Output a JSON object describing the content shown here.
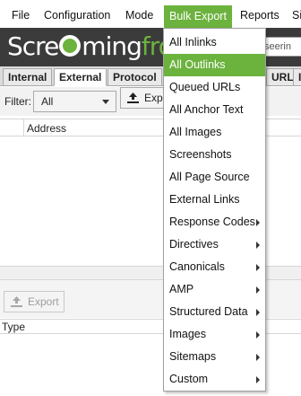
{
  "menubar": {
    "items": [
      {
        "label": "File"
      },
      {
        "label": "Configuration"
      },
      {
        "label": "Mode"
      },
      {
        "label": "Bulk Export"
      },
      {
        "label": "Reports"
      },
      {
        "label": "Si"
      }
    ]
  },
  "logo": {
    "part1": "Scre",
    "part2": "ming",
    "part3": "frog"
  },
  "search": {
    "value": "seerin"
  },
  "tabs": [
    {
      "label": "Internal"
    },
    {
      "label": "External"
    },
    {
      "label": "Protocol"
    },
    {
      "label": "URL"
    },
    {
      "label": "I"
    }
  ],
  "filter": {
    "label": "Filter:",
    "value": "All",
    "export_label": "Expo"
  },
  "table": {
    "address_header": "Address"
  },
  "lower": {
    "export_label": "Export",
    "type_header": "Type"
  },
  "dropdown": {
    "items": [
      {
        "label": "All Inlinks",
        "submenu": false
      },
      {
        "label": "All Outlinks",
        "submenu": false
      },
      {
        "label": "Queued URLs",
        "submenu": false
      },
      {
        "label": "All Anchor Text",
        "submenu": false
      },
      {
        "label": "All Images",
        "submenu": false
      },
      {
        "label": "Screenshots",
        "submenu": false
      },
      {
        "label": "All Page Source",
        "submenu": false
      },
      {
        "label": "External Links",
        "submenu": false
      },
      {
        "label": "Response Codes",
        "submenu": true
      },
      {
        "label": "Directives",
        "submenu": true
      },
      {
        "label": "Canonicals",
        "submenu": true
      },
      {
        "label": "AMP",
        "submenu": true
      },
      {
        "label": "Structured Data",
        "submenu": true
      },
      {
        "label": "Images",
        "submenu": true
      },
      {
        "label": "Sitemaps",
        "submenu": true
      },
      {
        "label": "Custom",
        "submenu": true
      }
    ]
  },
  "colors": {
    "accent": "#6cb33e",
    "logo_band": "#3b3b3b"
  }
}
